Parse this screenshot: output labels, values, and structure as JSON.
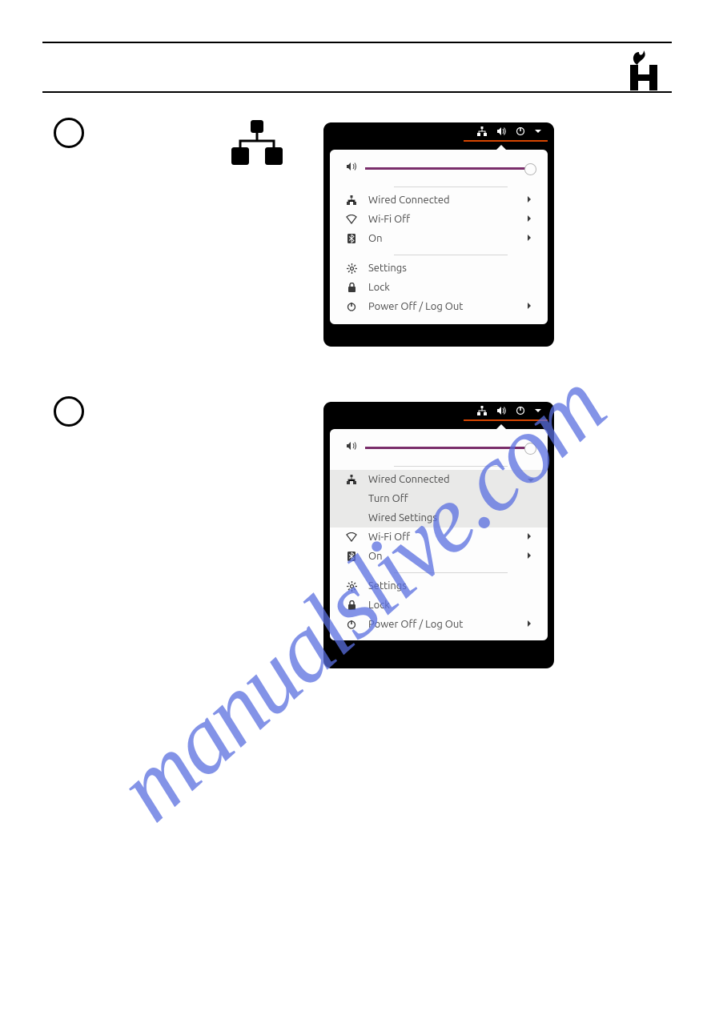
{
  "watermark": "manualslive.com",
  "panel1": {
    "wired": "Wired Connected",
    "wifi": "Wi-Fi Off",
    "bt": "On",
    "settings": "Settings",
    "lock": "Lock",
    "power": "Power Off / Log Out"
  },
  "panel2": {
    "wired": "Wired Connected",
    "wired_sub1": "Turn Off",
    "wired_sub2": "Wired Settings",
    "wifi": "Wi-Fi Off",
    "bt": "On",
    "settings": "Settings",
    "lock": "Lock",
    "power": "Power Off / Log Out"
  }
}
